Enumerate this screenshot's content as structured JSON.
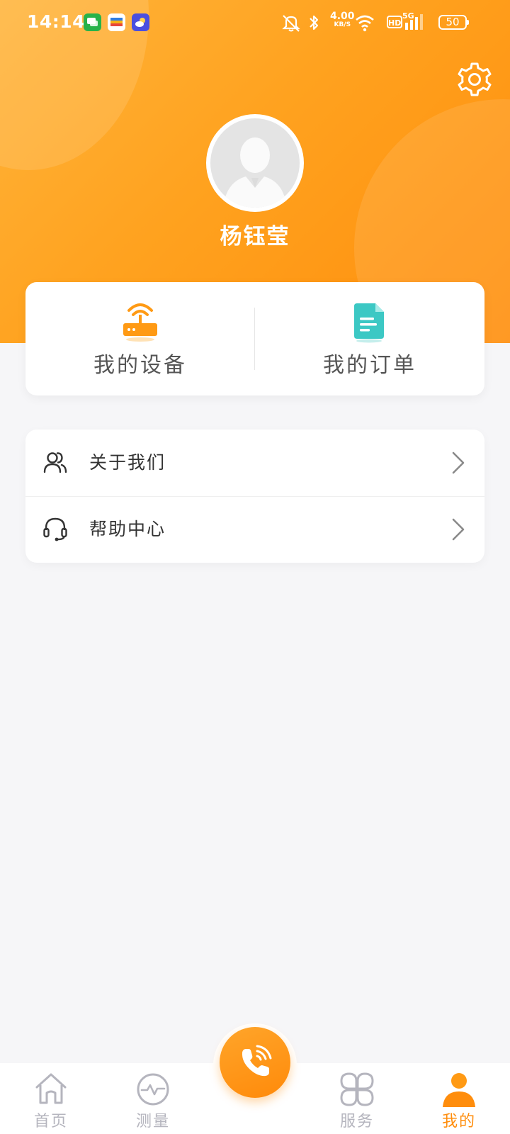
{
  "status_bar": {
    "time": "14:14",
    "network_speed": "4.00",
    "network_speed_unit": "KB/S",
    "hd_label": "HD",
    "signal_label": "5G",
    "battery": "50"
  },
  "profile": {
    "username": "杨钰莹"
  },
  "quick_actions": [
    {
      "label": "我的设备",
      "icon": "router-icon",
      "color": "#ff9a14"
    },
    {
      "label": "我的订单",
      "icon": "document-icon",
      "color": "#3cc8c4"
    }
  ],
  "menu": [
    {
      "label": "关于我们",
      "icon": "users-icon"
    },
    {
      "label": "帮助中心",
      "icon": "headset-icon"
    }
  ],
  "tabbar": {
    "tabs": [
      {
        "label": "首页",
        "icon": "home-icon",
        "active": false
      },
      {
        "label": "测量",
        "icon": "pulse-icon",
        "active": false
      },
      {
        "label": "服务",
        "icon": "grid-icon",
        "active": false
      },
      {
        "label": "我的",
        "icon": "person-icon",
        "active": true
      }
    ],
    "center_button_icon": "phone-call-icon"
  },
  "colors": {
    "accent": "#ff9a14",
    "teal": "#3cc8c4",
    "inactive": "#b5b5be",
    "background": "#f6f6f8"
  }
}
